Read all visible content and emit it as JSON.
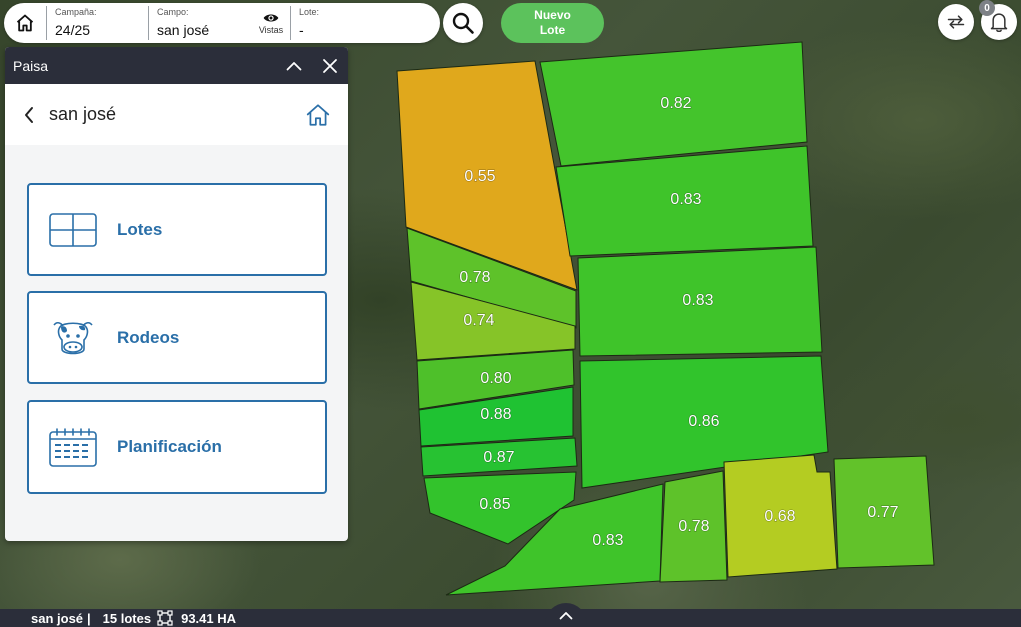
{
  "topbar": {
    "campana_caption": "Campaña:",
    "campana_value": "24/25",
    "campo_caption": "Campo:",
    "campo_value": "san josé",
    "vistas_label": "Vistas",
    "lote_caption": "Lote:",
    "lote_value": "-",
    "nuevo_lote_label": "Nuevo\nLote",
    "notification_count": "0"
  },
  "panel": {
    "title": "Paisa",
    "nav_title": "san josé",
    "items": [
      {
        "label": "Lotes",
        "icon": "grid-icon"
      },
      {
        "label": "Rodeos",
        "icon": "cow-icon"
      },
      {
        "label": "Planificación",
        "icon": "calendar-icon"
      }
    ]
  },
  "lotes": [
    {
      "value": "0.82",
      "color": "#44c42c"
    },
    {
      "value": "0.55",
      "color": "#e0a81c"
    },
    {
      "value": "0.83",
      "color": "#3fc42a"
    },
    {
      "value": "0.78",
      "color": "#5ec22a"
    },
    {
      "value": "0.83",
      "color": "#3fc42a"
    },
    {
      "value": "0.74",
      "color": "#86c428"
    },
    {
      "value": "0.80",
      "color": "#4ec02a"
    },
    {
      "value": "0.88",
      "color": "#1fc232"
    },
    {
      "value": "0.86",
      "color": "#31c42c"
    },
    {
      "value": "0.87",
      "color": "#27c232"
    },
    {
      "value": "0.85",
      "color": "#33c32c"
    },
    {
      "value": "0.83",
      "color": "#3fc42a"
    },
    {
      "value": "0.78",
      "color": "#5ec22a"
    },
    {
      "value": "0.68",
      "color": "#b4cc22"
    },
    {
      "value": "0.77",
      "color": "#62c22a"
    }
  ],
  "bottombar": {
    "campo": "san josé",
    "separator": "|",
    "lotes_count": "15 lotes",
    "area": "93.41 HA"
  }
}
